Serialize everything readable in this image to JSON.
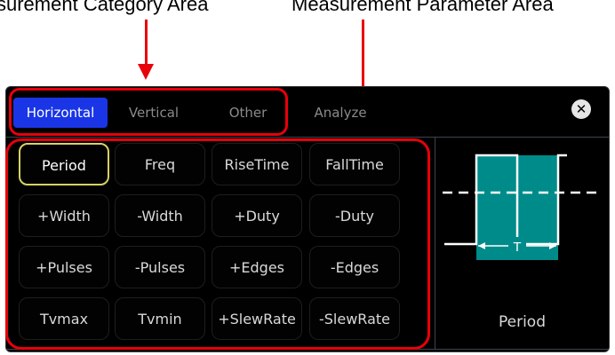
{
  "annotations": {
    "category_label": "surement Category Area",
    "parameter_label": "Measurement Parameter Area"
  },
  "tabs": [
    {
      "label": "Horizontal",
      "active": true
    },
    {
      "label": "Vertical",
      "active": false
    },
    {
      "label": "Other",
      "active": false
    },
    {
      "label": "Analyze",
      "active": false
    }
  ],
  "close_glyph": "✕",
  "parameters": [
    [
      "Period",
      "Freq",
      "RiseTime",
      "FallTime"
    ],
    [
      "+Width",
      "-Width",
      "+Duty",
      "-Duty"
    ],
    [
      "+Pulses",
      "-Pulses",
      "+Edges",
      "-Edges"
    ],
    [
      "Tvmax",
      "Tvmin",
      "+SlewRate",
      "-SlewRate"
    ]
  ],
  "selected_parameter": "Period",
  "preview": {
    "label": "Period",
    "symbol": "T",
    "fill_color": "#008b8b"
  },
  "colors": {
    "accent_tab": "#1a35e6",
    "selection_border": "#d9d266",
    "annotation_red": "#e8000b"
  }
}
